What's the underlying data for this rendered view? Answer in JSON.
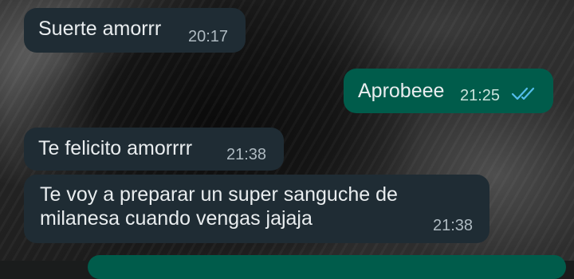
{
  "chat": {
    "messages": [
      {
        "direction": "incoming",
        "text": "Suerte amorrr",
        "time": "20:17"
      },
      {
        "direction": "outgoing",
        "text": "Aprobeee",
        "time": "21:25",
        "status": "read",
        "status_icon": "double-check-icon"
      },
      {
        "direction": "incoming",
        "text": "Te felicito amorrrr",
        "time": "21:38"
      },
      {
        "direction": "incoming",
        "lines": [
          "Te voy a preparar un super sanguche de",
          "milanesa cuando vengas jajaja"
        ],
        "time": "21:38"
      }
    ]
  },
  "colors": {
    "incoming_bubble": "#1f2c34",
    "outgoing_bubble": "#005c4b",
    "text": "#e9edef",
    "timestamp": "#aebac1",
    "read_ticks": "#53bdeb"
  }
}
